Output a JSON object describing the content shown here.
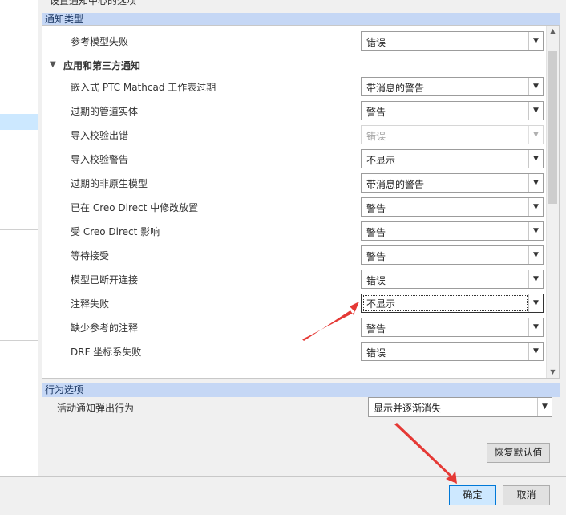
{
  "top_title": "设置通知中心的选项",
  "section_notification_types": "通知类型",
  "rows": [
    {
      "label": "参考模型失败",
      "value": "错误"
    },
    {
      "label": "应用和第三方通知"
    },
    {
      "label": "嵌入式 PTC  Mathcad 工作表过期",
      "value": "带消息的警告"
    },
    {
      "label": "过期的管道实体",
      "value": "警告"
    },
    {
      "label": "导入校验出错",
      "value": "错误",
      "disabled": true
    },
    {
      "label": "导入校验警告",
      "value": "不显示"
    },
    {
      "label": "过期的非原生模型",
      "value": "带消息的警告"
    },
    {
      "label": "已在 Creo Direct 中修改放置",
      "value": "警告"
    },
    {
      "label": "受 Creo Direct 影响",
      "value": "警告"
    },
    {
      "label": "等待接受",
      "value": "警告"
    },
    {
      "label": "模型已断开连接",
      "value": "错误"
    },
    {
      "label": "注释失败",
      "value": "不显示",
      "focused": true
    },
    {
      "label": "缺少参考的注释",
      "value": "警告"
    },
    {
      "label": "DRF 坐标系失败",
      "value": "错误"
    }
  ],
  "section_behavior": "行为选项",
  "behavior": {
    "label": "活动通知弹出行为",
    "value": "显示并逐渐消失"
  },
  "buttons": {
    "restore_defaults": "恢复默认值",
    "ok": "确定",
    "cancel": "取消"
  },
  "accent_color": "#e53935"
}
